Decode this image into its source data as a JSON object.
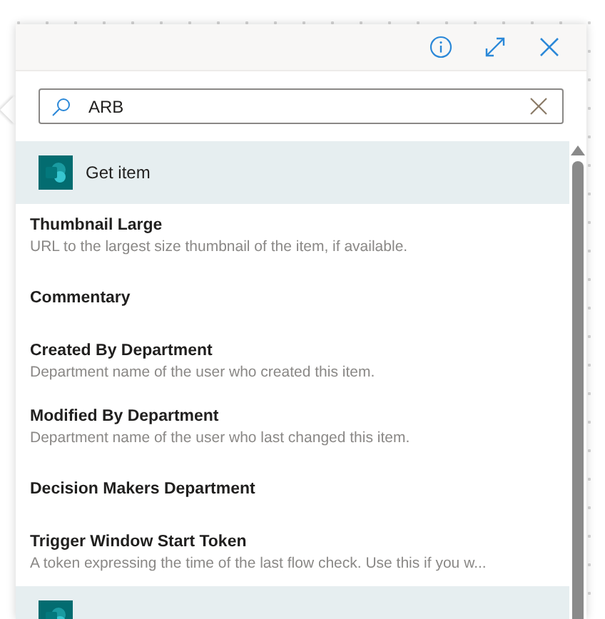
{
  "search": {
    "value": "ARB"
  },
  "groups": [
    {
      "title": "Get item",
      "fields": [
        {
          "name": "Thumbnail Large",
          "description": "URL to the largest size thumbnail of the item, if available."
        },
        {
          "name": "Commentary"
        },
        {
          "name": "Created By Department",
          "description": "Department name of the user who created this item."
        },
        {
          "name": "Modified By Department",
          "description": "Department name of the user who last changed this item."
        },
        {
          "name": "Decision Makers Department"
        },
        {
          "name": "Trigger Window Start Token",
          "description": "A token expressing the time of the last flow check. Use this if you w..."
        }
      ]
    }
  ]
}
